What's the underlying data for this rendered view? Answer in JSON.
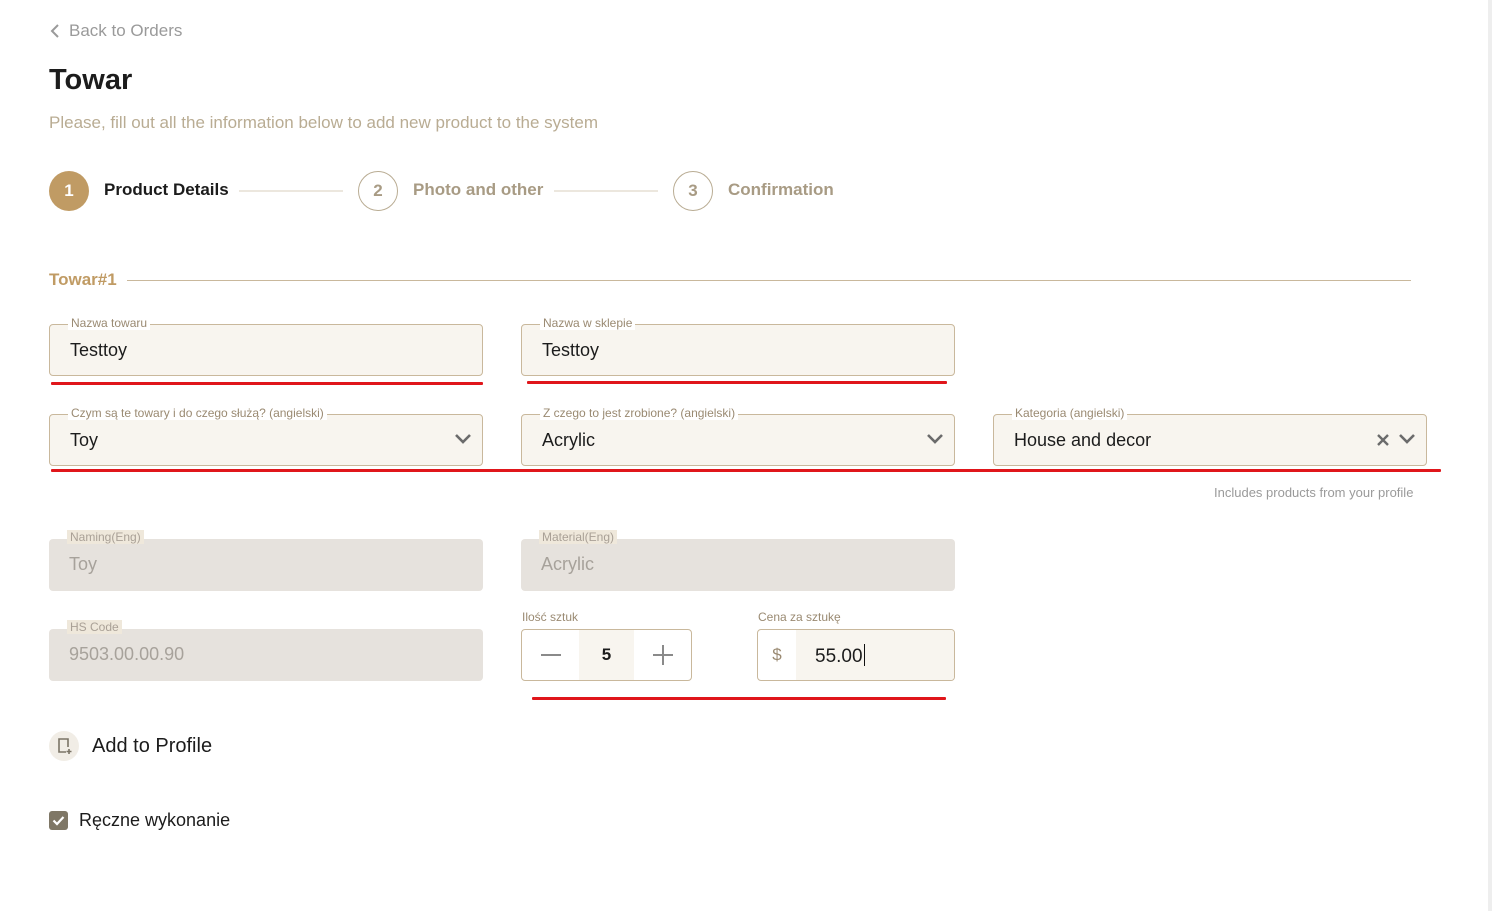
{
  "nav": {
    "back_label": "Back to Orders"
  },
  "header": {
    "title": "Towar",
    "subtitle": "Please, fill out all the information below to add new product to the system"
  },
  "stepper": [
    {
      "number": "1",
      "label": "Product Details",
      "state": "active"
    },
    {
      "number": "2",
      "label": "Photo and other",
      "state": "inactive"
    },
    {
      "number": "3",
      "label": "Confirmation",
      "state": "inactive"
    }
  ],
  "section": {
    "title": "Towar#1"
  },
  "fields": {
    "nazwa_towaru": {
      "label": "Nazwa towaru",
      "value": "Testtoy"
    },
    "nazwa_w_sklepie": {
      "label": "Nazwa w sklepie",
      "value": "Testtoy"
    },
    "czym_sa": {
      "label": "Czym są te towary i do czego służą? (angielski)",
      "value": "Toy"
    },
    "z_czego": {
      "label": "Z czego to jest zrobione? (angielski)",
      "value": "Acrylic"
    },
    "kategoria": {
      "label": "Kategoria (angielski)",
      "value": "House and decor",
      "helper": "Includes products from your profile"
    },
    "naming_eng": {
      "label": "Naming(Eng)",
      "value": "Toy"
    },
    "material_eng": {
      "label": "Material(Eng)",
      "value": "Acrylic"
    },
    "hs_code": {
      "label": "HS Code",
      "value": "9503.00.00.90"
    },
    "ilosc": {
      "label": "Ilość sztuk",
      "value": "5"
    },
    "cena": {
      "label": "Cena za sztukę",
      "currency": "$",
      "value": "55.00"
    }
  },
  "add_to_profile": {
    "label": "Add to Profile"
  },
  "handmade": {
    "label": "Ręczne wykonanie",
    "checked": true
  },
  "colors": {
    "accent": "#c09b64",
    "field_bg": "#f8f5ef",
    "disabled_bg": "#e6e2dd",
    "error_underline": "#e0161b"
  },
  "icons": [
    "chevron-left-icon",
    "chevron-down-icon",
    "clear-icon",
    "minus-icon",
    "plus-icon",
    "add-to-profile-icon",
    "check-icon"
  ]
}
